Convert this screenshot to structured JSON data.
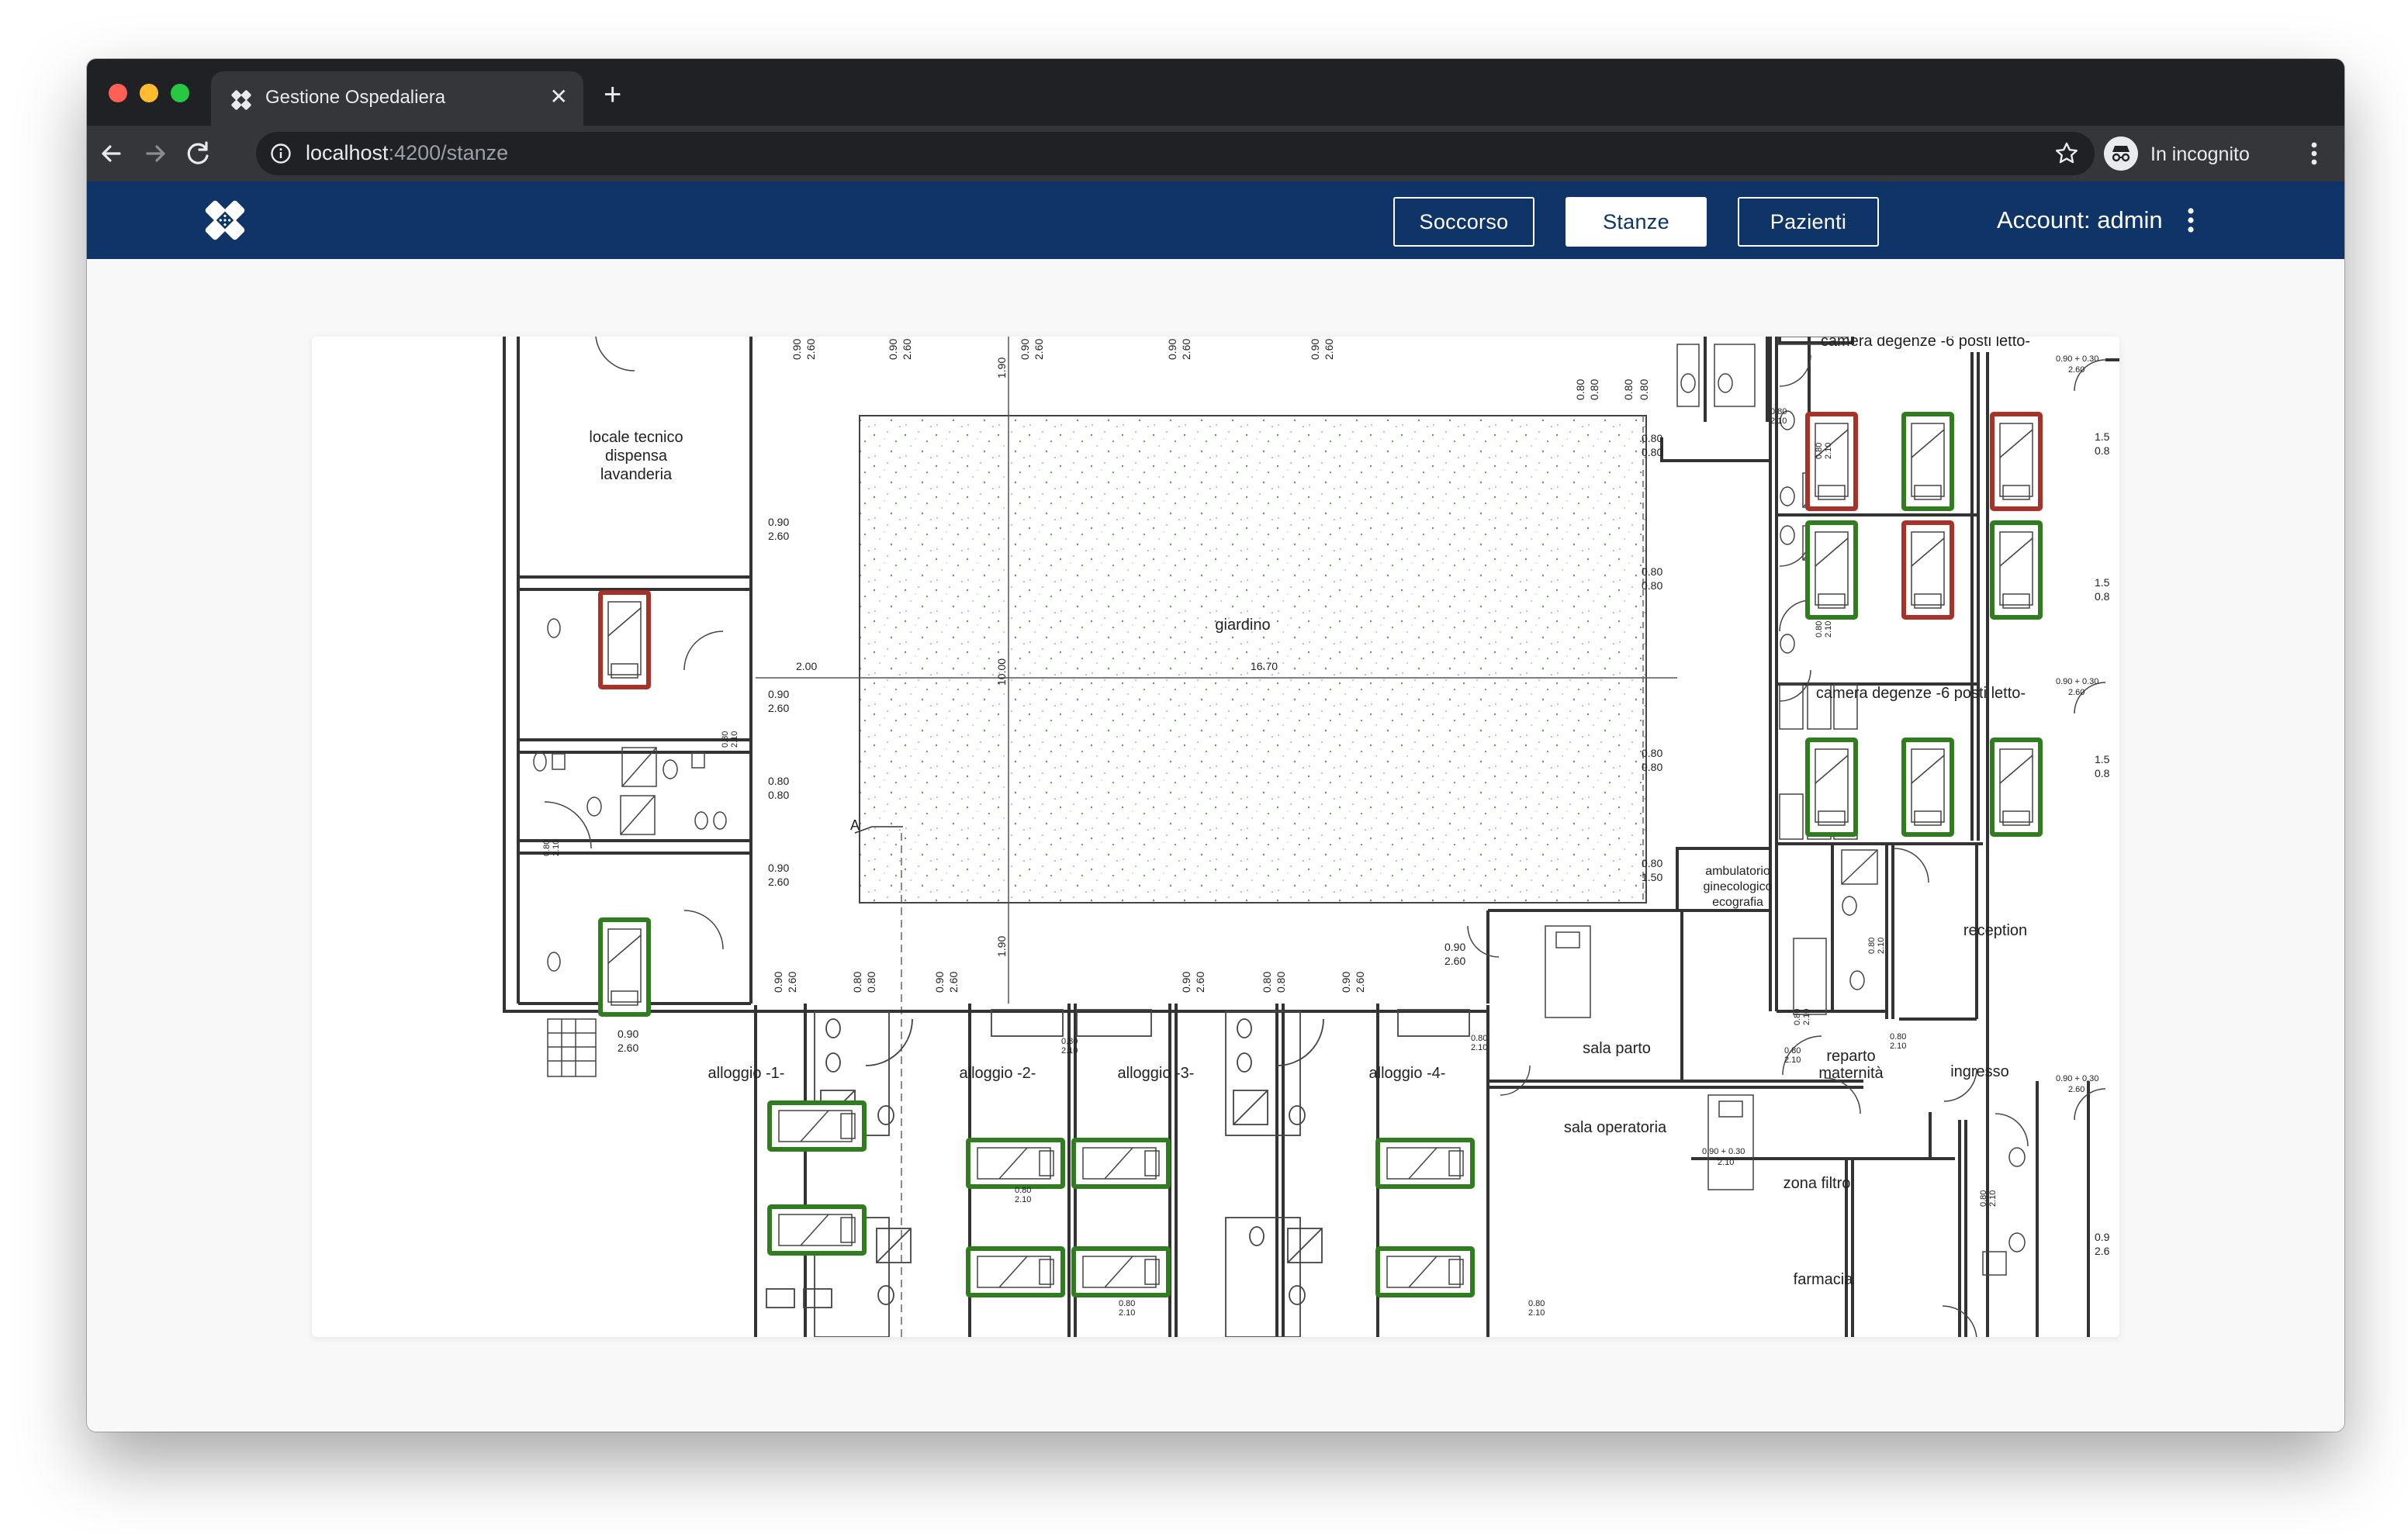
{
  "browser": {
    "tab_title": "Gestione Ospedaliera",
    "url_host": "localhost",
    "url_rest": ":4200/stanze",
    "incognito_label": "In incognito"
  },
  "app": {
    "nav": [
      {
        "label": "Soccorso",
        "active": false
      },
      {
        "label": "Stanze",
        "active": true
      },
      {
        "label": "Pazienti",
        "active": false
      }
    ],
    "account_label": "Account: admin"
  },
  "colors": {
    "brand": "#0f3467",
    "bed_occupied": "#a83228",
    "bed_free": "#2f7d1e"
  },
  "floorplan": {
    "rooms": {
      "locale_tecnico": [
        "locale tecnico",
        "dispensa",
        "lavanderia"
      ],
      "giardino": "giardino",
      "camera_top": "camera degenze -6 posti letto-",
      "camera_mid": "camera degenze -6 posti letto-",
      "ambulatorio": [
        "ambulatorio",
        "ginecologico",
        "ecografia"
      ],
      "reception": "reception",
      "sala_parto": "sala parto",
      "reparto": [
        "reparto",
        "maternità"
      ],
      "ingresso": "ingresso",
      "sala_operatoria": "sala operatoria",
      "zona_filtro": "zona filtro",
      "farmacia": "farmacia",
      "alloggio_1": "alloggio -1-",
      "alloggio_2": "alloggio -2-",
      "alloggio_3": "alloggio -3-",
      "alloggio_4": "alloggio -4-"
    },
    "dimensions": {
      "d1": "0.90",
      "d1b": "2.60",
      "d2": "0.80",
      "d2b": "0.80",
      "d3": "0.80",
      "d3b": "1.50",
      "d4": "2.00",
      "d5": "16.70",
      "d6": "10.00",
      "d7": "1.90",
      "d8": "0.90 + 0.30",
      "d8b": "2.60",
      "d9": "0.80",
      "d9b": "2.10",
      "d10": "1.5",
      "d10b": "0.8",
      "d11": "0.9",
      "d11b": "2.6",
      "section_mark": "A"
    },
    "beds": [
      {
        "label": "bed-left-upper",
        "status": "occupied"
      },
      {
        "label": "bed-left-lower",
        "status": "free"
      },
      {
        "label": "bed-c1-1",
        "status": "occupied"
      },
      {
        "label": "bed-c1-2",
        "status": "free"
      },
      {
        "label": "bed-c1-3",
        "status": "occupied"
      },
      {
        "label": "bed-c1-4",
        "status": "free"
      },
      {
        "label": "bed-c1-5",
        "status": "occupied"
      },
      {
        "label": "bed-c1-6",
        "status": "free"
      },
      {
        "label": "bed-c2-1",
        "status": "free"
      },
      {
        "label": "bed-c2-2",
        "status": "free"
      },
      {
        "label": "bed-c2-3",
        "status": "free"
      },
      {
        "label": "bed-a1-1",
        "status": "free"
      },
      {
        "label": "bed-a1-2",
        "status": "free"
      },
      {
        "label": "bed-a2-1",
        "status": "free"
      },
      {
        "label": "bed-a2-2",
        "status": "free"
      },
      {
        "label": "bed-a3-1",
        "status": "free"
      },
      {
        "label": "bed-a3-2",
        "status": "free"
      },
      {
        "label": "bed-a4-1",
        "status": "free"
      },
      {
        "label": "bed-a4-2",
        "status": "free"
      }
    ]
  }
}
